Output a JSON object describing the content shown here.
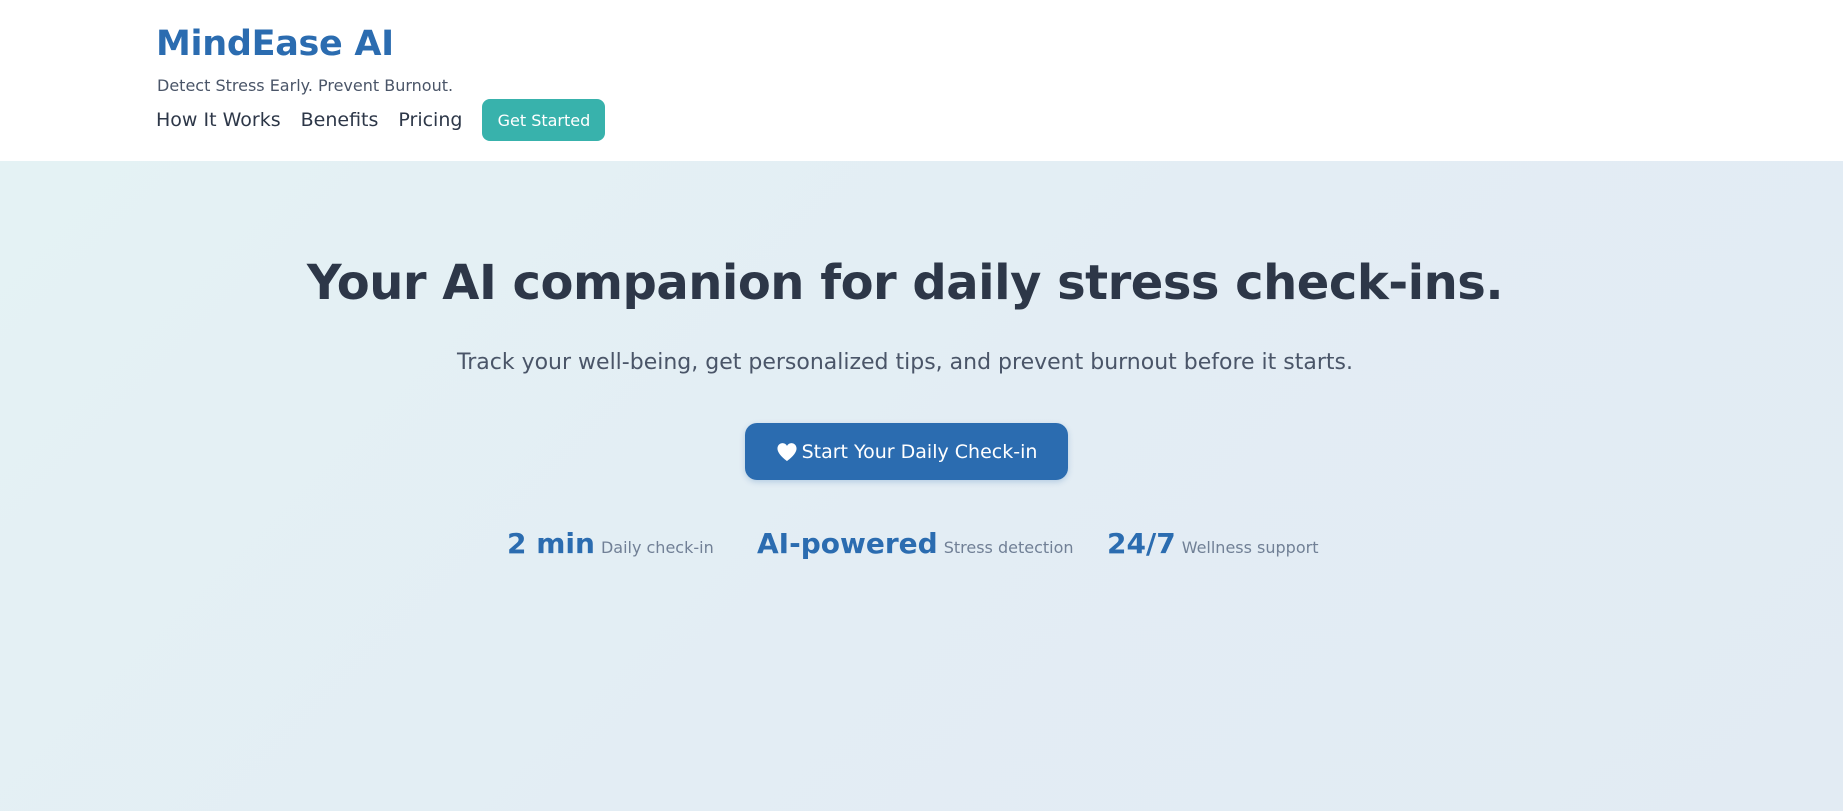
{
  "header": {
    "brand": "MindEase AI",
    "tagline": "Detect Stress Early. Prevent Burnout.",
    "nav": [
      {
        "label": "How It Works"
      },
      {
        "label": "Benefits"
      },
      {
        "label": "Pricing"
      }
    ],
    "cta_label": "Get Started"
  },
  "hero": {
    "title": "Your AI companion for daily stress check-ins.",
    "subtitle": "Track your well-being, get personalized tips, and prevent burnout before it starts.",
    "button_label": "Start Your Daily Check-in",
    "button_icon": "heart-icon"
  },
  "stats": [
    {
      "value": "2 min",
      "label": "Daily check-in"
    },
    {
      "value": "AI-powered",
      "label": "Stress detection"
    },
    {
      "value": "24/7",
      "label": "Wellness support"
    }
  ],
  "colors": {
    "brand": "#2b6cb0",
    "accent": "#38b2ac",
    "text_dark": "#2d3748",
    "text_muted": "#718096",
    "hero_bg": "#e3edf4"
  }
}
